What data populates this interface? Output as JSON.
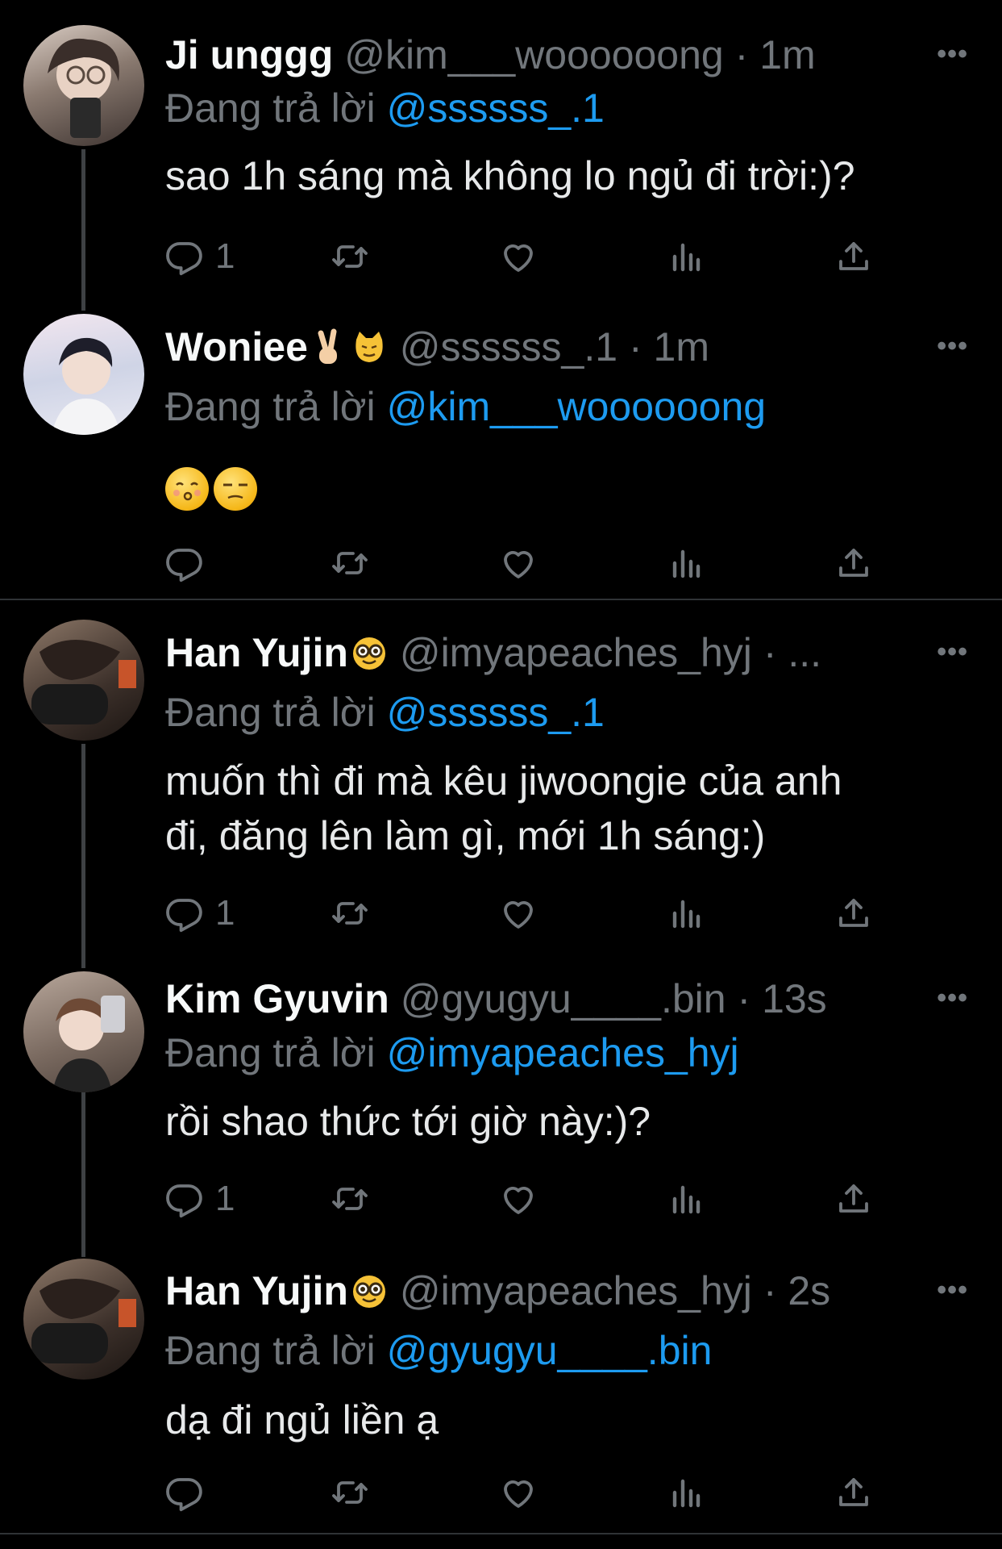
{
  "tweets": [
    {
      "name": "Ji unggg",
      "handle": "@kim___woooooong",
      "sep": "·",
      "time": "1m",
      "reply_prefix": "Đang trả lời",
      "reply_mention": "@ssssss_.1",
      "text": "sao 1h sáng mà không lo ngủ đi trời:)?",
      "reply_count": "1",
      "avatar_color": "#8a7a70"
    },
    {
      "name": "Woniee",
      "name_emojis": [
        "victory-hand-emoji",
        "cat-emoji"
      ],
      "handle": "@ssssss_.1",
      "sep": "·",
      "time": "1m",
      "reply_prefix": "Đang trả lời",
      "reply_mention": "@kim___woooooong",
      "body_emojis": [
        "kissing-face-emoji",
        "unamused-face-emoji"
      ],
      "reply_count": "",
      "avatar_color": "#cfd4e6"
    },
    {
      "name": "Han Yujin",
      "name_emojis": [
        "nerd-face-emoji"
      ],
      "handle": "@imyapeaches_hyj",
      "sep": "·",
      "time": "...",
      "reply_prefix": "Đang trả lời",
      "reply_mention": "@ssssss_.1",
      "text_line1": "muốn thì đi mà kêu jiwoongie của anh",
      "text_line2": "đi, đăng lên làm gì, mới 1h sáng:)",
      "reply_count": "1",
      "avatar_color": "#6b5a4e"
    },
    {
      "name": "Kim Gyuvin",
      "handle": "@gyugyu____.bin",
      "sep": "·",
      "time": "13s",
      "reply_prefix": "Đang trả lời",
      "reply_mention": "@imyapeaches_hyj",
      "text": "rồi shao thức tới giờ này:)?",
      "reply_count": "1",
      "avatar_color": "#9a8a80"
    },
    {
      "name": "Han Yujin",
      "name_emojis": [
        "nerd-face-emoji"
      ],
      "handle": "@imyapeaches_hyj",
      "sep": "·",
      "time": "2s",
      "reply_prefix": "Đang trả lời",
      "reply_mention": "@gyugyu____.bin",
      "text": "dạ đi ngủ liền ạ",
      "reply_count": "",
      "avatar_color": "#6b5a4e"
    }
  ],
  "icons": [
    "reply-icon",
    "retweet-icon",
    "like-icon",
    "views-icon",
    "share-icon",
    "more-icon"
  ],
  "colors": {
    "background": "#000000",
    "mention": "#1d9bf0",
    "muted": "#71767b",
    "text": "#e7e9ea"
  }
}
